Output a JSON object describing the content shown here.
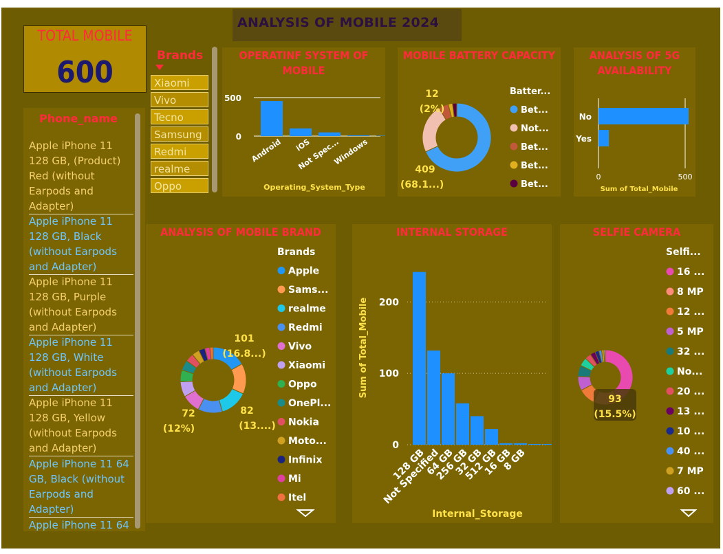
{
  "header": {
    "title": "ANALYSIS OF MOBILE 2024"
  },
  "kpi": {
    "label": "TOTAL MOBILE",
    "value": "600"
  },
  "phone_list": {
    "header": "Phone_name",
    "items": [
      "Apple iPhone 11 128 GB, (Product) Red (without Earpods and Adapter)",
      "Apple iPhone 11 128 GB, Black (without Earpods and Adapter)",
      "Apple iPhone 11 128 GB, Purple (without Earpods and Adapter)",
      "Apple iPhone 11 128 GB, White (without Earpods and Adapter)",
      "Apple iPhone 11 128 GB, Yellow (without Earpods and Adapter)",
      "Apple iPhone 11 64 GB, Black (without Earpods and Adapter)",
      "Apple iPhone 11 64"
    ]
  },
  "brand_slicer": {
    "header": "Brands",
    "items": [
      "Xiaomi",
      "Vivo",
      "Tecno",
      "Samsung",
      "Redmi",
      "realme",
      "Oppo"
    ]
  },
  "panels": {
    "os": "OPERATINF SYSTEM OF MOBILE",
    "battery": "MOBILE BATTERY CAPACITY",
    "fiveg": "ANALYSIS OF 5G AVAILABILITY",
    "brand": "ANALYSIS OF MOBILE BRAND",
    "storage": "INTERNAL STORAGE",
    "selfie": "SELFIE CAMERA"
  },
  "chart_data": [
    {
      "type": "bar",
      "title": "OPERATINF SYSTEM OF MOBILE",
      "xlabel": "Operating_System_Type",
      "ylabel": "",
      "categories": [
        "Android",
        "iOS",
        "Not Spec...",
        "Windows",
        ""
      ],
      "values": [
        455,
        100,
        48,
        10,
        5
      ],
      "yticks": [
        "500",
        "0"
      ],
      "ylim": [
        0,
        500
      ],
      "color": "#1e90ff"
    },
    {
      "type": "pie",
      "title": "MOBILE BATTERY CAPACITY",
      "legend_title": "Batter...",
      "labels": [
        "Bet...",
        "Not...",
        "Bet...",
        "Bet...",
        "Bet..."
      ],
      "values": [
        409,
        139,
        28,
        12,
        12
      ],
      "colors": [
        "#3fa0f5",
        "#f2c0b0",
        "#c0583a",
        "#e0b020",
        "#5a0040"
      ],
      "data_labels": [
        {
          "value": "409",
          "pct": "(68.1...)"
        },
        {
          "value": "12",
          "pct": "(2%)"
        }
      ]
    },
    {
      "type": "bar",
      "orientation": "horizontal",
      "title": "ANALYSIS OF 5G AVAILABILITY",
      "xlabel": "Sum of Total_Mobile",
      "categories": [
        "No",
        "Yes"
      ],
      "values": [
        540,
        60
      ],
      "xticks": [
        "0",
        "500"
      ],
      "xlim": [
        0,
        500
      ],
      "color": "#1e90ff"
    },
    {
      "type": "pie",
      "title": "ANALYSIS OF MOBILE BRAND",
      "legend_title": "Brands",
      "labels": [
        "Apple",
        "Sams...",
        "realme",
        "Redmi",
        "Vivo",
        "Xiaomi",
        "Oppo",
        "OnePl...",
        "Nokia",
        "Moto...",
        "Infinix",
        "Mi",
        "Itel"
      ],
      "values": [
        101,
        90,
        82,
        72,
        55,
        45,
        35,
        30,
        25,
        22,
        18,
        15,
        10
      ],
      "colors": [
        "#2196f3",
        "#ff9a50",
        "#1ec8e8",
        "#4a90f0",
        "#e070d0",
        "#c0a0f0",
        "#30b050",
        "#1a8a8a",
        "#e05060",
        "#d0a020",
        "#1a237e",
        "#e040a0",
        "#f07040"
      ],
      "data_labels": [
        {
          "value": "101",
          "pct": "(16.8...)"
        },
        {
          "value": "82",
          "pct": "(13....)"
        },
        {
          "value": "72",
          "pct": "(12%)"
        }
      ]
    },
    {
      "type": "bar",
      "title": "INTERNAL STORAGE",
      "xlabel": "Internal_Storage",
      "ylabel": "Sum of Total_Mobile",
      "categories": [
        "128 GB",
        "Not Specified",
        "64 GB",
        "256 GB",
        "32 GB",
        "512 GB",
        "16 GB",
        "8 GB",
        "",
        ""
      ],
      "values": [
        242,
        132,
        100,
        58,
        40,
        22,
        2,
        2,
        1,
        1
      ],
      "yticks": [
        "200",
        "100",
        "0"
      ],
      "ylim": [
        0,
        260
      ],
      "color": "#1e90ff"
    },
    {
      "type": "pie",
      "title": "SELFIE CAMERA",
      "legend_title": "Selfi...",
      "labels": [
        "16 ...",
        "8 MP",
        "12 ...",
        "5 MP",
        "32 ...",
        "No...",
        "20 ...",
        "13 ...",
        "10 ...",
        "40 ...",
        "7 MP",
        "60 ..."
      ],
      "values": [
        250,
        93,
        60,
        50,
        40,
        30,
        22,
        18,
        14,
        10,
        8,
        5
      ],
      "colors": [
        "#e84ab0",
        "#ff8c7a",
        "#f07a3a",
        "#c060d0",
        "#1a7a7a",
        "#1ed0a0",
        "#e05060",
        "#6a0060",
        "#1a2a8a",
        "#4a90f0",
        "#d0a020",
        "#c0a0f0"
      ],
      "data_labels": [
        {
          "value": "93",
          "pct": "(15.5%)"
        }
      ]
    }
  ]
}
